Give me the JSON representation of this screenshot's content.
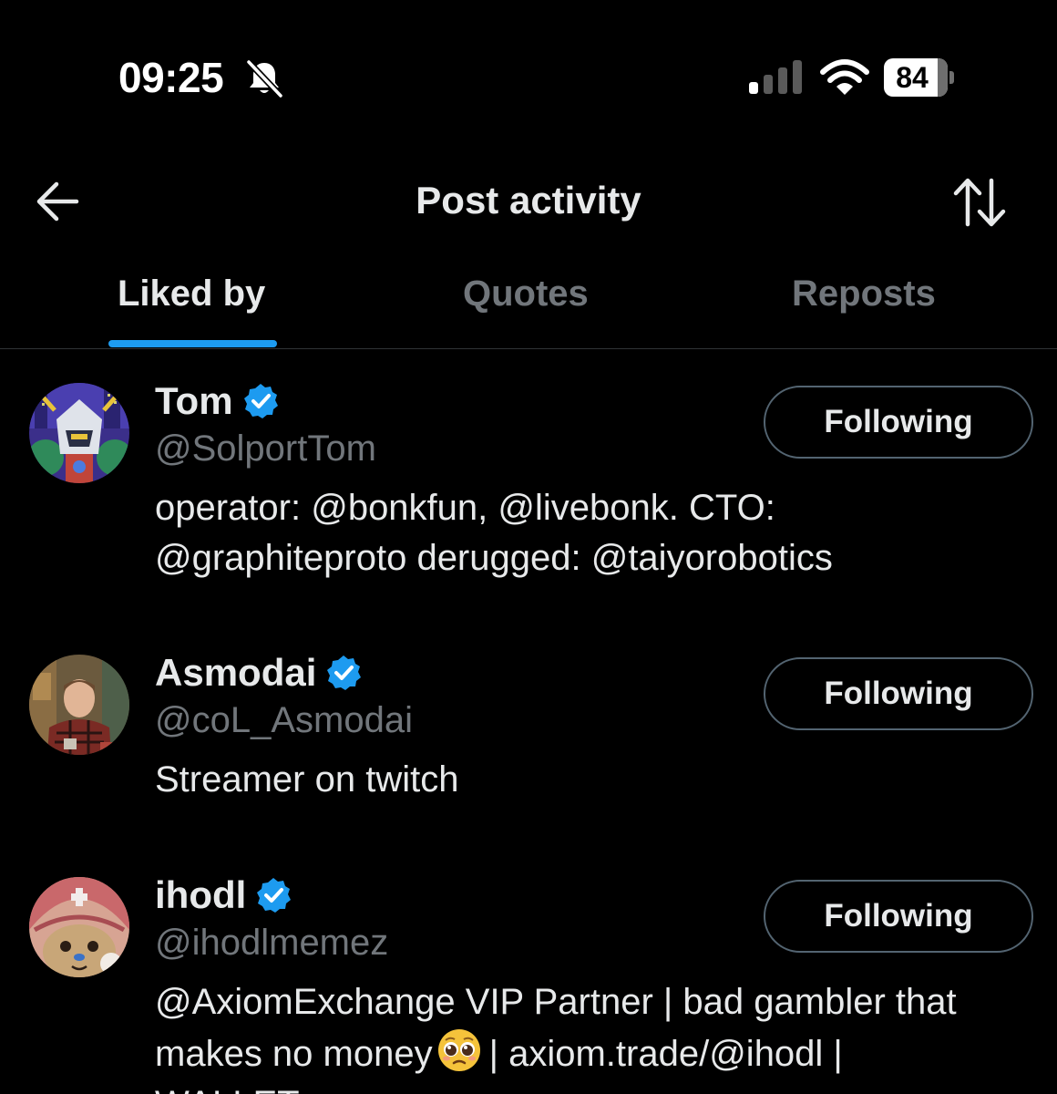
{
  "status_bar": {
    "time": "09:25",
    "battery": "84",
    "icons": [
      "bell-slash-icon",
      "cellular-signal-icon",
      "wifi-icon",
      "battery-icon"
    ]
  },
  "header": {
    "title": "Post activity",
    "back_icon": "arrow-left-icon",
    "sort_icon": "sort-arrows-icon"
  },
  "tabs": [
    {
      "label": "Liked by",
      "active": true
    },
    {
      "label": "Quotes",
      "active": false
    },
    {
      "label": "Reposts",
      "active": false
    }
  ],
  "users": [
    {
      "name": "Tom",
      "handle": "@SolportTom",
      "verified": true,
      "button": "Following",
      "bio_lines": [
        "operator: @bonkfun, @livebonk. CTO:",
        "@graphiteproto derugged: @taiyorobotics"
      ]
    },
    {
      "name": "Asmodai",
      "handle": "@coL_Asmodai",
      "verified": true,
      "button": "Following",
      "bio_lines": [
        "Streamer on twitch"
      ]
    },
    {
      "name": "ihodl",
      "handle": "@ihodlmemez",
      "verified": true,
      "button": "Following",
      "bio_lines": [
        "@AxiomExchange VIP Partner | bad gambler that",
        "makes no money",
        "| axiom.trade/@ihodl |",
        "WALLET"
      ],
      "bio_emoji": "pleading-face-emoji"
    }
  ],
  "colors": {
    "background": "#000000",
    "text_primary": "#e7e9ea",
    "text_secondary": "#71767b",
    "accent": "#1d9bf0",
    "divider": "#2f3336",
    "button_border": "#536471"
  }
}
